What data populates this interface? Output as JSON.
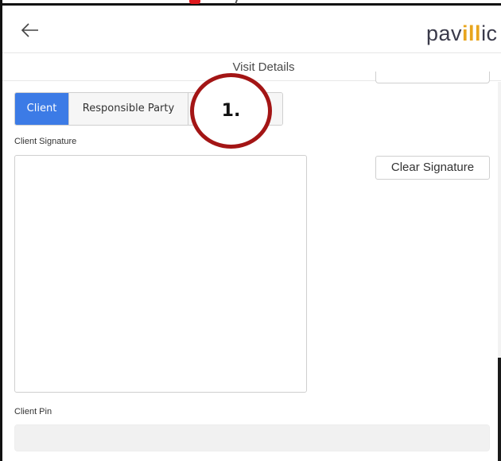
{
  "header": {
    "brand_prefix": "pav",
    "brand_accent": "ill",
    "brand_suffix": "ic",
    "brand_accent_color": "#e8a51d",
    "back_icon": "arrow-left-icon"
  },
  "subheader": {
    "title": "Visit Details"
  },
  "tabs": [
    {
      "label": "Client",
      "active": true
    },
    {
      "label": "Responsible Party",
      "active": false
    },
    {
      "label": "",
      "active": false
    }
  ],
  "annotation": {
    "number": "1."
  },
  "signature": {
    "label": "Client Signature",
    "clear_label": "Clear Signature"
  },
  "pin": {
    "label": "Client Pin",
    "value": ""
  },
  "colors": {
    "active_tab": "#3c7be6",
    "callout_ring": "#a31515"
  }
}
